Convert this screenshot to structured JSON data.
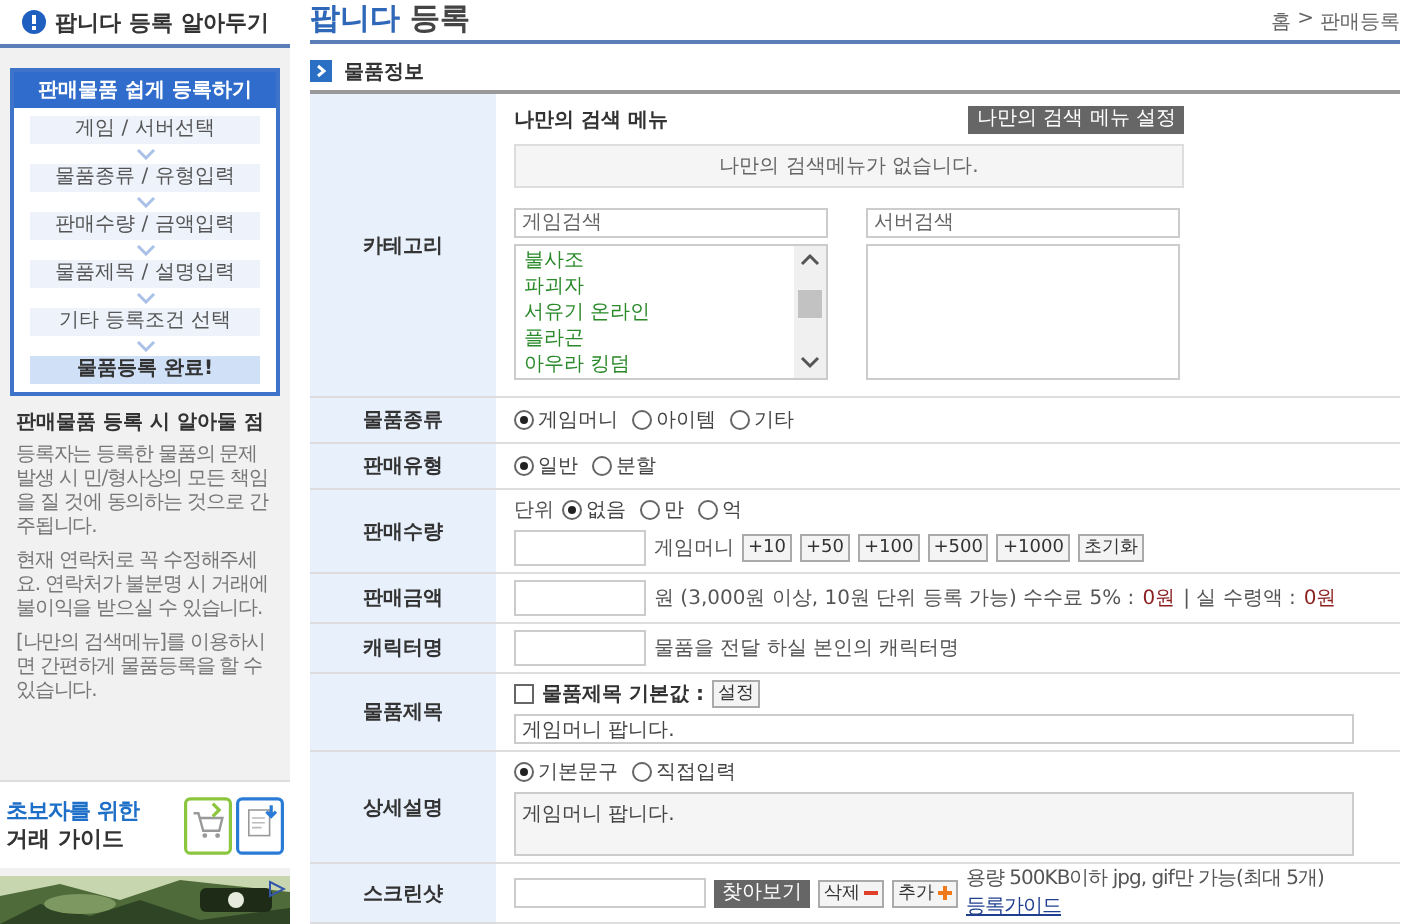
{
  "sidebar": {
    "title": "팝니다 등록 알아두기",
    "guide": {
      "title": "판매물품 쉽게 등록하기",
      "steps": [
        {
          "label": "게임 / 서버선택",
          "final": false
        },
        {
          "label": "물품종류 / 유형입력",
          "final": false
        },
        {
          "label": "판매수량 / 금액입력",
          "final": false
        },
        {
          "label": "물품제목 / 설명입력",
          "final": false
        },
        {
          "label": "기타 등록조건 선택",
          "final": false
        },
        {
          "label": "물품등록 완료!",
          "final": true
        }
      ]
    },
    "notes": {
      "title": "판매물품 등록 시 알아둘 점",
      "items": [
        "등록자는 등록한 물품의 문제 발생 시 민/형사상의 모든 책임을 질 것에 동의하는 것으로 간주됩니다.",
        "현재 연락처로 꼭 수정해주세요. 연락처가 불분명 시 거래에 불이익을 받으실 수 있습니다.",
        "[나만의 검색메뉴]를 이용하시면 간편하게 물품등록을 할 수 있습니다."
      ]
    },
    "banner": {
      "line1": "초보자를 위한",
      "line2": "거래 가이드"
    }
  },
  "header": {
    "title_accent": "팝니다",
    "title_rest": "등록",
    "breadcrumb": [
      "홈",
      "판매등록"
    ],
    "separator": ">"
  },
  "section": {
    "title": "물품정보"
  },
  "form": {
    "category": {
      "label": "카테고리",
      "my_menu_title": "나만의 검색 메뉴",
      "my_menu_button": "나만의 검색 메뉴 설정",
      "my_menu_empty": "나만의 검색메뉴가 없습니다.",
      "game_search": {
        "placeholder": "게임검색"
      },
      "server_search": {
        "placeholder": "서버검색"
      },
      "games": [
        "불사조",
        "파괴자",
        "서유기 온라인",
        "플라곤",
        "아우라 킹덤"
      ]
    },
    "item_type": {
      "label": "물품종류",
      "options": [
        {
          "label": "게임머니",
          "selected": true
        },
        {
          "label": "아이템",
          "selected": false
        },
        {
          "label": "기타",
          "selected": false
        }
      ]
    },
    "sale_type": {
      "label": "판매유형",
      "options": [
        {
          "label": "일반",
          "selected": true
        },
        {
          "label": "분할",
          "selected": false
        }
      ]
    },
    "quantity": {
      "label": "판매수량",
      "unit_label": "단위",
      "units": [
        {
          "label": "없음",
          "selected": true
        },
        {
          "label": "만",
          "selected": false
        },
        {
          "label": "억",
          "selected": false
        }
      ],
      "suffix": "게임머니",
      "buttons": [
        "+10",
        "+50",
        "+100",
        "+500",
        "+1000",
        "초기화"
      ]
    },
    "price": {
      "label": "판매금액",
      "note": "원 (3,000원 이상, 10원 단위 등록 가능) 수수료 5% :",
      "fee": "0원",
      "net_label": "| 실 수령액 :",
      "net": "0원"
    },
    "character": {
      "label": "캐릭터명",
      "hint": "물품을 전달 하실 본인의 캐릭터명"
    },
    "title": {
      "label": "물품제목",
      "default_label": "물품제목 기본값 :",
      "default_checked": false,
      "set_button": "설정",
      "value": "게임머니 팝니다."
    },
    "description": {
      "label": "상세설명",
      "options": [
        {
          "label": "기본문구",
          "selected": true
        },
        {
          "label": "직접입력",
          "selected": false
        }
      ],
      "value": "게임머니 팝니다."
    },
    "screenshot": {
      "label": "스크린샷",
      "browse": "찾아보기",
      "delete": "삭제",
      "add": "추가",
      "note": "용량 500KB이하 jpg, gif만 가능(최대 5개)",
      "guide_link": "등록가이드"
    }
  }
}
